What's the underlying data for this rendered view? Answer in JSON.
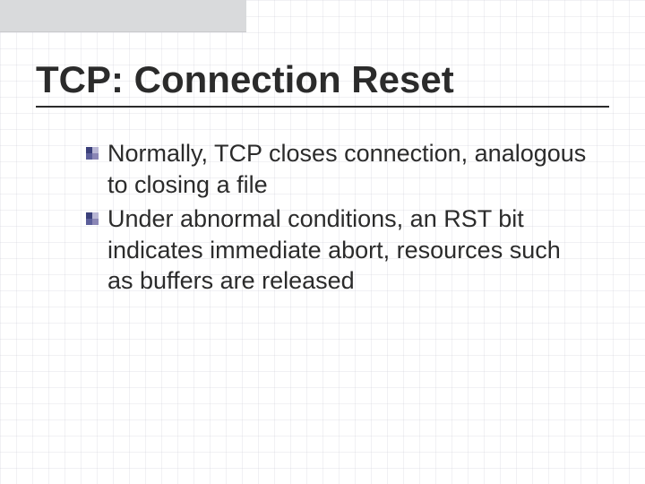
{
  "slide": {
    "title": "TCP: Connection Reset",
    "bullets": [
      {
        "text": "Normally, TCP closes connection, analogous to closing a file"
      },
      {
        "text": "Under abnormal conditions, an RST bit indicates immediate abort, resources such as buffers are released"
      }
    ]
  },
  "colors": {
    "text": "#2b2b2b",
    "bullet_dark": "#3a3f7a",
    "bullet_light": "#b8b6d4",
    "top_strip": "#d9dadc"
  }
}
